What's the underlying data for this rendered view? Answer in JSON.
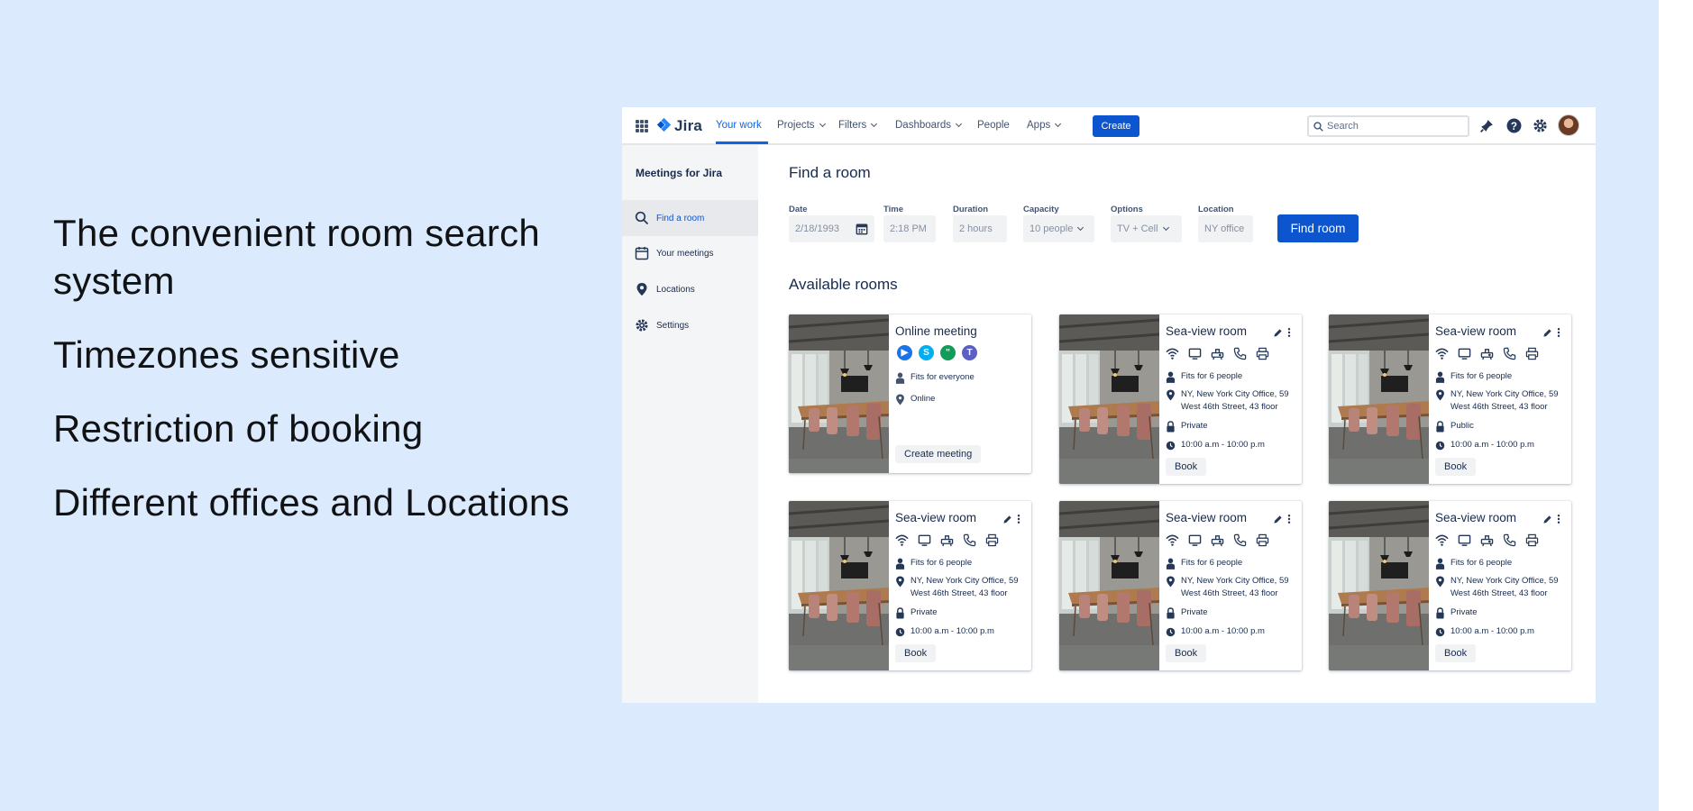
{
  "features": [
    "The convenient room search system",
    "Timezones sensitive",
    "Restriction of booking",
    "Different offices and Locations"
  ],
  "nav": {
    "brand": "Jira",
    "items": [
      {
        "label": "Your work",
        "dropdown": false
      },
      {
        "label": "Projects",
        "dropdown": true
      },
      {
        "label": "Filters",
        "dropdown": true
      },
      {
        "label": "Dashboards",
        "dropdown": true
      },
      {
        "label": "People",
        "dropdown": false
      },
      {
        "label": "Apps",
        "dropdown": true
      }
    ],
    "create_label": "Create",
    "search_placeholder": "Search",
    "accent": "#0c55cf"
  },
  "sidebar": {
    "title": "Meetings for Jira",
    "items": [
      {
        "label": "Find a room",
        "icon": "search-icon"
      },
      {
        "label": "Your meetings",
        "icon": "calendar-icon"
      },
      {
        "label": "Locations",
        "icon": "location-pin-icon"
      },
      {
        "label": "Settings",
        "icon": "gear-icon"
      }
    ]
  },
  "search_form": {
    "title": "Find a room",
    "fields": [
      {
        "label": "Date",
        "value": "2/18/1993"
      },
      {
        "label": "Time",
        "value": "2:18 PM"
      },
      {
        "label": "Duration",
        "value": "2 hours"
      },
      {
        "label": "Capacity",
        "value": "10 people"
      },
      {
        "label": "Options",
        "value": "TV + Cell"
      },
      {
        "label": "Location",
        "value": "NY office"
      }
    ],
    "submit_label": "Find room"
  },
  "rooms": {
    "title": "Available rooms",
    "online": {
      "name": "Online meeting",
      "capacity": "Fits for everyone",
      "location": "Online",
      "action_label": "Create meeting"
    },
    "cards": [
      {
        "name": "Sea-view room",
        "capacity": "Fits for 6 people",
        "address": "NY, New York City Office, 59 West 46th Street, 43 floor",
        "access": "Private",
        "hours": "10:00 a.m - 10:00 p.m",
        "action_label": "Book"
      },
      {
        "name": "Sea-view room",
        "capacity": "Fits for 6 people",
        "address": "NY, New York City Office, 59 West 46th Street, 43 floor",
        "access": "Public",
        "hours": "10:00 a.m - 10:00 p.m",
        "action_label": "Book"
      },
      {
        "name": "Sea-view room",
        "capacity": "Fits for 6 people",
        "address": "NY, New York City Office, 59 West 46th Street, 43 floor",
        "access": "Private",
        "hours": "10:00 a.m - 10:00 p.m",
        "action_label": "Book"
      },
      {
        "name": "Sea-view room",
        "capacity": "Fits for 6 people",
        "address": "NY, New York City Office, 59 West 46th Street, 43 floor",
        "access": "Private",
        "hours": "10:00 a.m - 10:00 p.m",
        "action_label": "Book"
      },
      {
        "name": "Sea-view room",
        "capacity": "Fits for 6 people",
        "address": "NY, New York City Office, 59 West 46th Street, 43 floor",
        "access": "Private",
        "hours": "10:00 a.m - 10:00 p.m",
        "action_label": "Book"
      }
    ]
  }
}
